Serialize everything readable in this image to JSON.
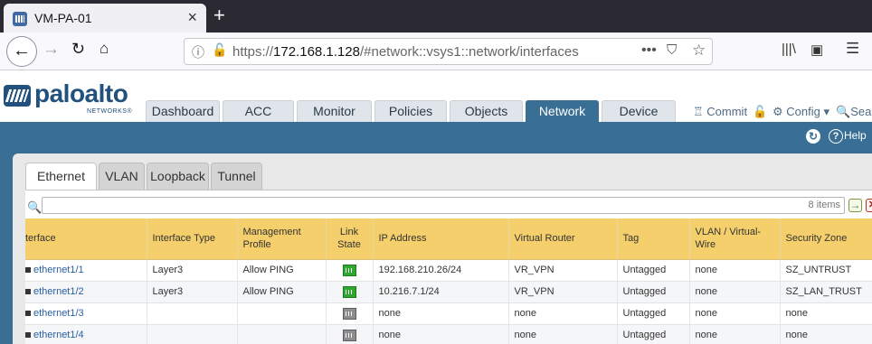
{
  "browser": {
    "tab_title": "VM-PA-01",
    "tab_close": "×",
    "new_tab": "+",
    "url_prefix": "https://",
    "url_host": "172.168.1.128",
    "url_path": "/#network::vsys1::network/interfaces",
    "url_more": "•••"
  },
  "app": {
    "logo_word": "paloalto",
    "logo_sub": "NETWORKS®",
    "main_tabs": [
      {
        "label": "Dashboard"
      },
      {
        "label": "ACC"
      },
      {
        "label": "Monitor"
      },
      {
        "label": "Policies"
      },
      {
        "label": "Objects"
      },
      {
        "label": "Network"
      },
      {
        "label": "Device"
      }
    ],
    "active_main_tab": "Network",
    "actions": {
      "commit": "Commit",
      "config": "Config",
      "search": "Sear"
    },
    "help": "Help"
  },
  "interfaces": {
    "sub_tabs": [
      {
        "label": "Ethernet"
      },
      {
        "label": "VLAN"
      },
      {
        "label": "Loopback"
      },
      {
        "label": "Tunnel"
      }
    ],
    "active_sub_tab": "Ethernet",
    "filter_value": "",
    "items_count": "8 items",
    "columns": [
      "terface",
      "Interface Type",
      "Management Profile",
      "Link State",
      "IP Address",
      "Virtual Router",
      "Tag",
      "VLAN / Virtual-Wire",
      "Security Zone"
    ],
    "rows": [
      {
        "interface": "ethernet1/1",
        "type": "Layer3",
        "mgmt_profile": "Allow PING",
        "link_state": "up",
        "ip": "192.168.210.26/24",
        "vr": "VR_VPN",
        "tag": "Untagged",
        "vlan": "none",
        "zone": "SZ_UNTRUST"
      },
      {
        "interface": "ethernet1/2",
        "type": "Layer3",
        "mgmt_profile": "Allow PING",
        "link_state": "up",
        "ip": "10.216.7.1/24",
        "vr": "VR_VPN",
        "tag": "Untagged",
        "vlan": "none",
        "zone": "SZ_LAN_TRUST"
      },
      {
        "interface": "ethernet1/3",
        "type": "",
        "mgmt_profile": "",
        "link_state": "down",
        "ip": "none",
        "vr": "none",
        "tag": "Untagged",
        "vlan": "none",
        "zone": "none"
      },
      {
        "interface": "ethernet1/4",
        "type": "",
        "mgmt_profile": "",
        "link_state": "down",
        "ip": "none",
        "vr": "none",
        "tag": "Untagged",
        "vlan": "none",
        "zone": "none"
      }
    ]
  },
  "colors": {
    "brand_blue": "#3a6f95",
    "header_yellow": "#f5cf6b",
    "link_up": "#2ea82e",
    "link_down": "#8d8d8d"
  }
}
